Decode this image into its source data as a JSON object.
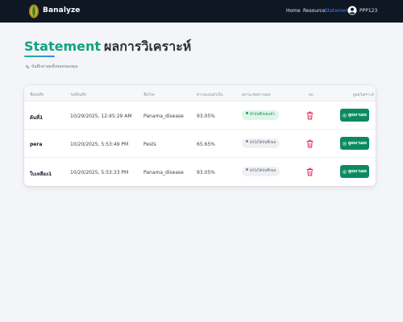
{
  "nav": {
    "brand": "Banalyze",
    "links": [
      "Home",
      "Resource",
      "Statement"
    ],
    "active_link": "Statement",
    "username": "PPP123"
  },
  "header": {
    "title_en": "Statement",
    "title_th": "ผลการวิเคราะห์",
    "subtitle": "บันทึกล่าสุดทั้งหมดของคุณ"
  },
  "table": {
    "columns": [
      "ชื่อบันทึก",
      "วันที่บันทึก",
      "ชื่อโรค",
      "ความแม่นยำเป็น",
      "สถานะจัดความผล",
      "ลบ",
      "ดูผลวิเคราะห์"
    ],
    "rows": [
      {
        "name": "ต้นที่1",
        "date": "10/29/2025, 12:45:29 AM",
        "disease": "Panama_disease",
        "confidence": "93.05%",
        "status": "ทำบันทึกผลแล้ว",
        "status_type": "done",
        "action": "ดูผลงานผล"
      },
      {
        "name": "pera",
        "date": "10/20/2025, 5:53:49 PM",
        "disease": "Pests",
        "confidence": "65.65%",
        "status": "ยังไม่ได้บันทึกผล",
        "status_type": "pending",
        "action": "ดูผลงานผล"
      },
      {
        "name": "ใบเหลือง1",
        "date": "10/20/2025, 5:53:33 PM",
        "disease": "Panama_disease",
        "confidence": "93.05%",
        "status": "ยังไม่ได้บันทึกผล",
        "status_type": "pending",
        "action": "ดูผลงานผล"
      }
    ]
  },
  "colors": {
    "accent": "#11a37f",
    "nav_bg": "#0f1624",
    "button": "#0b8a62",
    "delete": "#e11d48"
  }
}
